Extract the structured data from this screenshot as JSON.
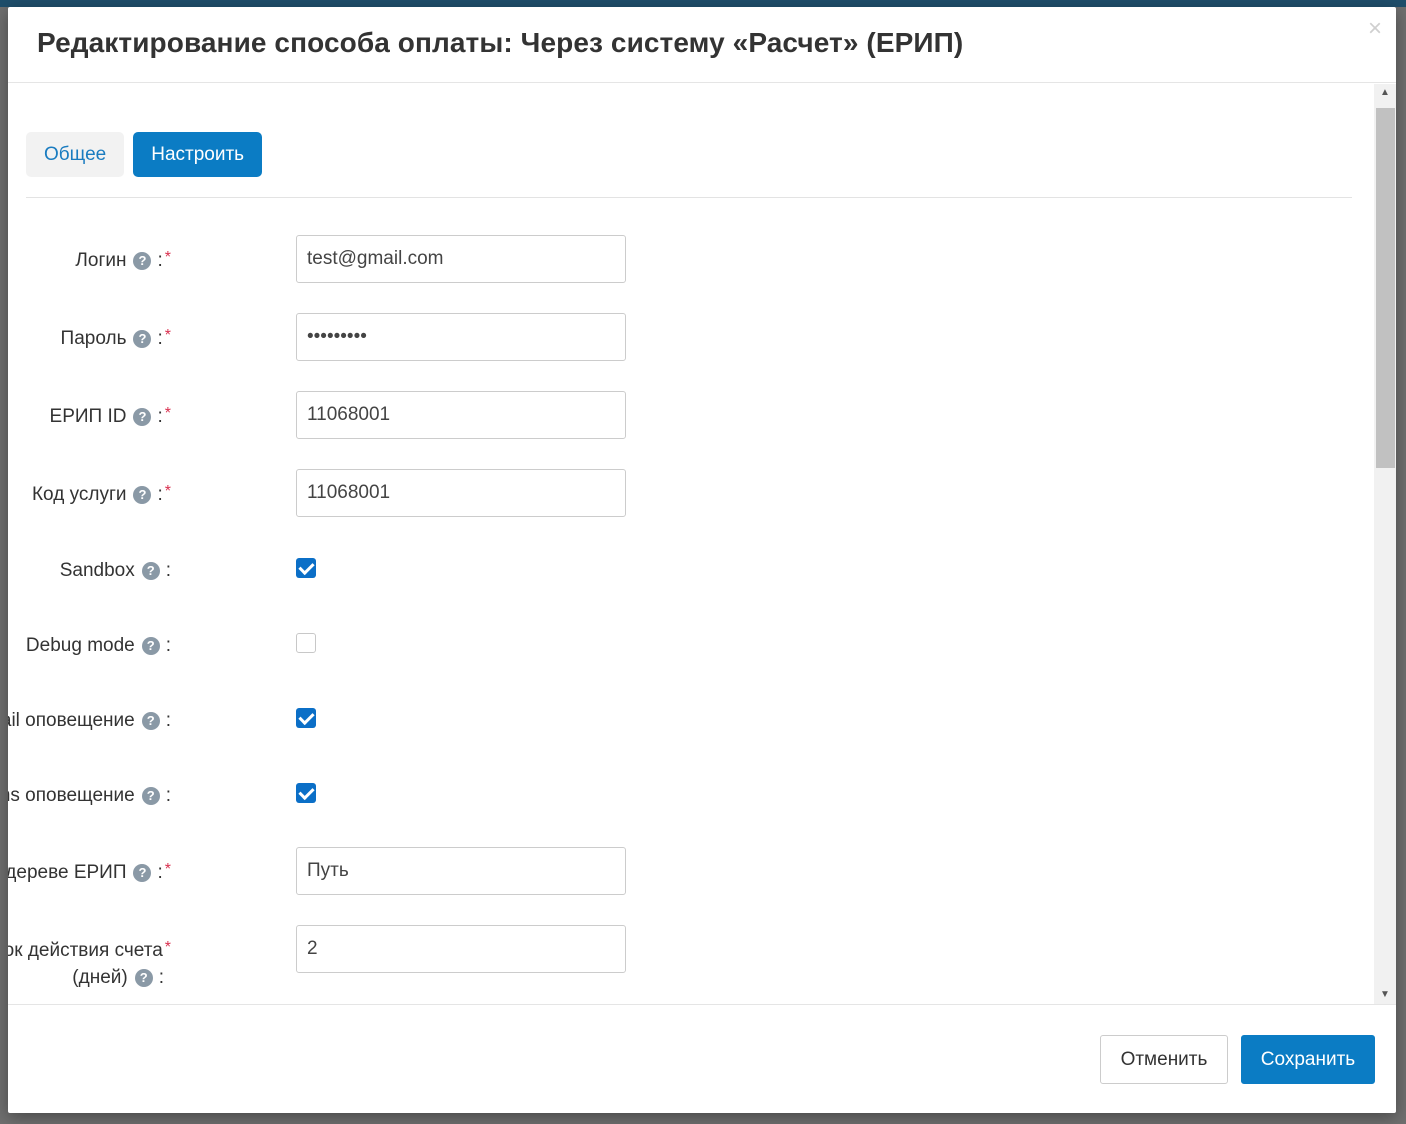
{
  "modal": {
    "title": "Редактирование способа оплаты: Через систему «Расчет» (ЕРИП)",
    "close_label": "×"
  },
  "tabs": [
    {
      "label": "Общее",
      "active": false
    },
    {
      "label": "Настроить",
      "active": true
    }
  ],
  "fields": {
    "login": {
      "label": "Логин",
      "value": "test@gmail.com",
      "required": true
    },
    "password": {
      "label": "Пароль",
      "value": "•••••••••",
      "required": true
    },
    "erip_id": {
      "label": "ЕРИП ID",
      "value": "11068001",
      "required": true
    },
    "service_code": {
      "label": "Код услуги",
      "value": "11068001",
      "required": true
    },
    "sandbox": {
      "label": "Sandbox",
      "checked": true
    },
    "debug_mode": {
      "label": "Debug mode",
      "checked": false
    },
    "email_notify": {
      "label": "Email оповещение",
      "checked": true
    },
    "sms_notify": {
      "label": "Sms оповещение",
      "checked": true
    },
    "erip_path": {
      "label": "Путь в дереве ЕРИП",
      "value": "Путь",
      "required": true
    },
    "invoice_term": {
      "label_line1": "Срок действия счета",
      "label_line2": "(дней)",
      "value": "2",
      "required": true
    }
  },
  "common": {
    "help_glyph": "?",
    "colon": ":",
    "required_mark": "*"
  },
  "footer": {
    "cancel_label": "Отменить",
    "save_label": "Сохранить"
  },
  "colors": {
    "primary": "#0b7cc4",
    "required": "#d9304f",
    "help_icon": "#8a99a6"
  }
}
